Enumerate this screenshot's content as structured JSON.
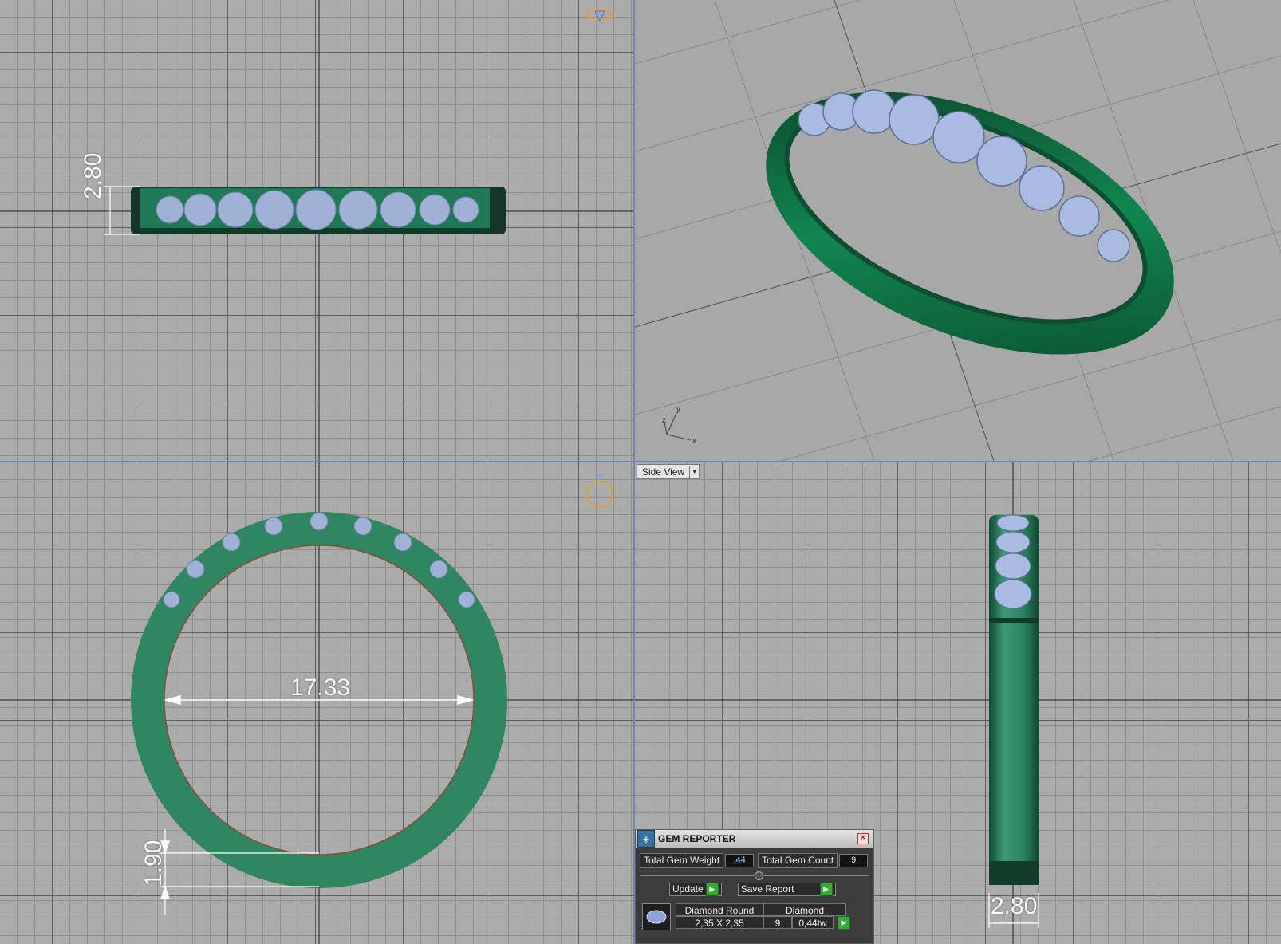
{
  "viewports": {
    "top": {
      "dimension_label": "2.80",
      "icon": "ring-with-gem-icon"
    },
    "perspective": {
      "axis_labels": {
        "z": "z",
        "y": "y",
        "x": "x"
      }
    },
    "front": {
      "diameter_label": "17.33",
      "thickness_label": "1.90",
      "icon": "ring-front-icon"
    },
    "side": {
      "view_selector_label": "Side View",
      "width_label": "2.80"
    }
  },
  "gem_reporter": {
    "title": "GEM REPORTER",
    "total_weight_label": "Total Gem Weight",
    "total_weight_value": ",44",
    "total_count_label": "Total Gem Count",
    "total_count_value": "9",
    "update_label": "Update",
    "save_report_label": "Save Report",
    "gems": [
      {
        "shape": "Diamond Round",
        "size": "2,35 X 2,35",
        "material": "Diamond",
        "count": "9",
        "weight": "0,44tw"
      }
    ]
  },
  "colors": {
    "metal": "#1f7a55",
    "gem": "#9fb2d6",
    "grid_major": "#5e5e5e",
    "grid_minor": "#8f8f8f",
    "viewport_border": "#6f86b7",
    "accent_button": "#39a935"
  }
}
